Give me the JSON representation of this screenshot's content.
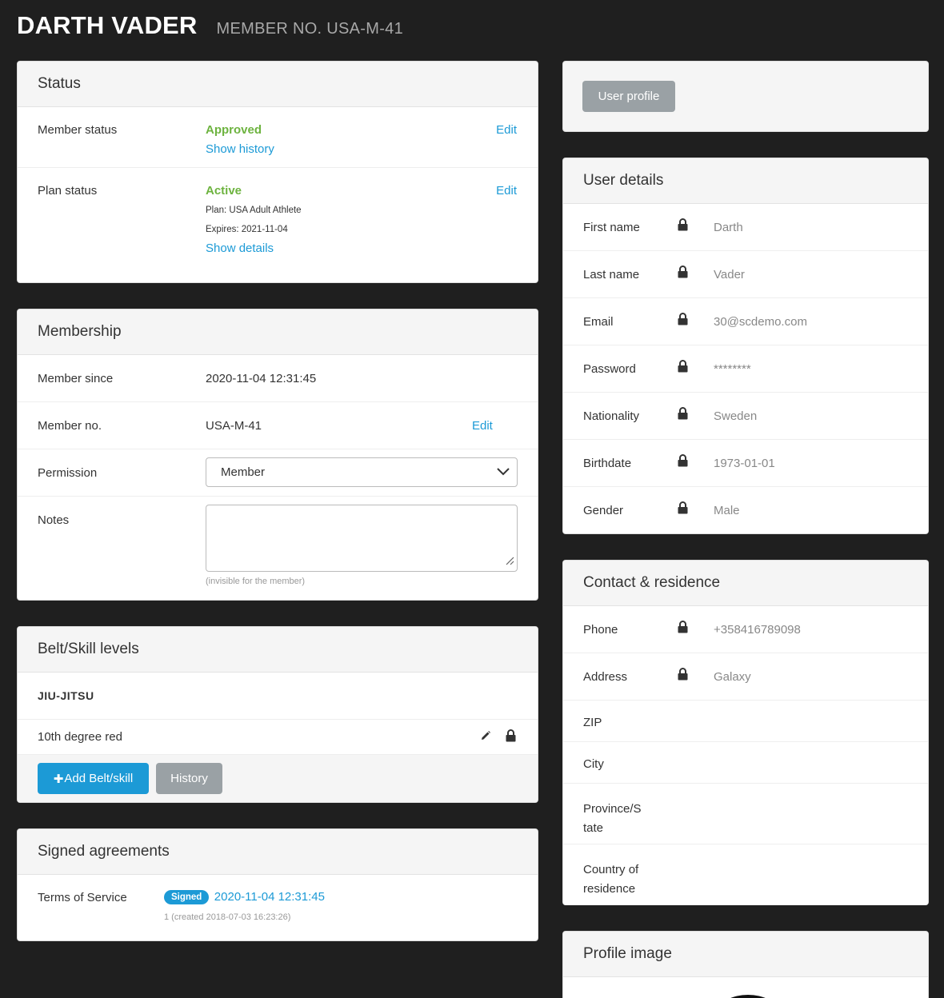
{
  "header": {
    "name": "DARTH VADER",
    "member_no": "MEMBER NO. USA-M-41"
  },
  "status": {
    "title": "Status",
    "member_status_label": "Member status",
    "member_status_value": "Approved",
    "show_history": "Show history",
    "edit": "Edit",
    "plan_status_label": "Plan status",
    "plan_status_value": "Active",
    "plan": "Plan: USA Adult Athlete",
    "expires": "Expires: 2021-11-04",
    "show_details": "Show details"
  },
  "membership": {
    "title": "Membership",
    "since_label": "Member since",
    "since_value": "2020-11-04 12:31:45",
    "no_label": "Member no.",
    "no_value": "USA-M-41",
    "edit": "Edit",
    "permission_label": "Permission",
    "permission_value": "Member",
    "notes_label": "Notes",
    "notes_hint": "(invisible for the member)"
  },
  "belts": {
    "title": "Belt/Skill levels",
    "discipline": "JIU-JITSU",
    "level": "10th degree red",
    "add_button": "Add Belt/skill",
    "history_button": "History"
  },
  "agreements": {
    "title": "Signed agreements",
    "tos_label": "Terms of Service",
    "badge": "Signed",
    "signed_at": "2020-11-04 12:31:45",
    "created": "1 (created 2018-07-03 16:23:26)"
  },
  "profile_button": "User profile",
  "user_details": {
    "title": "User details",
    "rows": [
      {
        "label": "First name",
        "value": "Darth"
      },
      {
        "label": "Last name",
        "value": "Vader"
      },
      {
        "label": "Email",
        "value": "30@scdemo.com"
      },
      {
        "label": "Password",
        "value": "********"
      },
      {
        "label": "Nationality",
        "value": "Sweden"
      },
      {
        "label": "Birthdate",
        "value": "1973-01-01"
      },
      {
        "label": "Gender",
        "value": "Male"
      }
    ]
  },
  "contact": {
    "title": "Contact & residence",
    "phone_label": "Phone",
    "phone_value": "+358416789098",
    "address_label": "Address",
    "address_value": "Galaxy",
    "zip_label": "ZIP",
    "city_label": "City",
    "province_line1": "Province/S",
    "province_line2": "tate",
    "country_line1": "Country of",
    "country_line2": "residence"
  },
  "profile_image": {
    "title": "Profile image"
  },
  "icons": {
    "lock": "lock-icon",
    "pencil": "pencil-icon",
    "chevron": "chevron-down-icon",
    "plus": "plus-icon"
  },
  "colors": {
    "accent": "#1c9ad6",
    "success": "#6db33f",
    "background": "#1f1f1f",
    "grey_button": "#9aa1a5"
  }
}
